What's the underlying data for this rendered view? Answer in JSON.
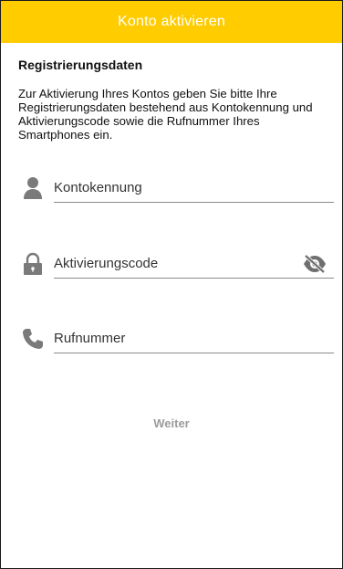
{
  "header": {
    "title": "Konto aktivieren",
    "background_color": "#ffcc00"
  },
  "section": {
    "title": "Registrierungsdaten",
    "intro": "Zur Aktivierung Ihres Kontos geben Sie bitte Ihre Registrierungsdaten bestehend aus Kontokennung und Aktivierungscode sowie die Rufnummer Ihres Smartphones ein."
  },
  "form": {
    "fields": [
      {
        "label": "Kontokennung",
        "icon": "person-icon"
      },
      {
        "label": "Aktivierungscode",
        "icon": "lock-icon",
        "trailing_icon": "eye-off-icon"
      },
      {
        "label": "Rufnummer",
        "icon": "phone-icon"
      }
    ]
  },
  "actions": {
    "next_label": "Weiter",
    "next_color": "#9b9b9b"
  }
}
